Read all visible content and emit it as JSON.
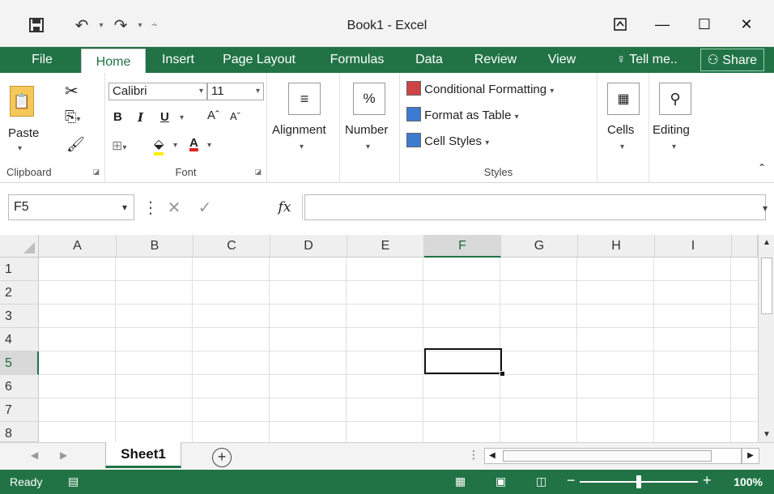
{
  "window": {
    "title": "Book1 - Excel"
  },
  "qat": {
    "save_icon": "save-icon",
    "undo_icon": "undo-icon",
    "redo_icon": "redo-icon"
  },
  "tabs": [
    {
      "label": "File"
    },
    {
      "label": "Home"
    },
    {
      "label": "Insert"
    },
    {
      "label": "Page Layout"
    },
    {
      "label": "Formulas"
    },
    {
      "label": "Data"
    },
    {
      "label": "Review"
    },
    {
      "label": "View"
    },
    {
      "label": "Tell me.."
    }
  ],
  "share_label": "Share",
  "ribbon": {
    "clipboard": {
      "label": "Clipboard",
      "paste": "Paste"
    },
    "font": {
      "label": "Font",
      "family": "Calibri",
      "size": "11"
    },
    "alignment": {
      "label": "Alignment"
    },
    "number": {
      "label": "Number",
      "symbol": "%"
    },
    "styles": {
      "label": "Styles",
      "conditional": "Conditional Formatting",
      "table": "Format as Table",
      "cellstyles": "Cell Styles"
    },
    "cells": {
      "label": "Cells"
    },
    "editing": {
      "label": "Editing"
    }
  },
  "formula": {
    "namebox": "F5",
    "fx": "fx"
  },
  "columns": [
    "A",
    "B",
    "C",
    "D",
    "E",
    "F",
    "G",
    "H",
    "I"
  ],
  "selected_column": "F",
  "rows": [
    "1",
    "2",
    "3",
    "4",
    "5",
    "6",
    "7",
    "8"
  ],
  "selected_row": "5",
  "sheets": [
    {
      "name": "Sheet1"
    }
  ],
  "status": {
    "ready": "Ready",
    "zoom": "100%"
  },
  "colors": {
    "accent": "#217346"
  }
}
